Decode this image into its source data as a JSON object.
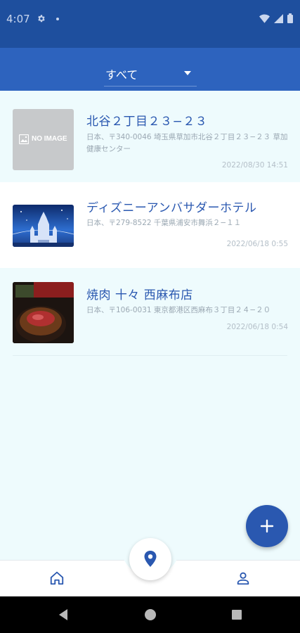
{
  "status_bar": {
    "time": "4:07"
  },
  "filter": {
    "selected": "すべて"
  },
  "places": [
    {
      "title": "北谷２丁目２３−２３",
      "address": "日本、〒340-0046 埼玉県草加市北谷２丁目２３−２３ 草加健康センター",
      "date": "2022/08/30 14:51",
      "thumb_text": "NO IMAGE",
      "thumb_type": "placeholder"
    },
    {
      "title": "ディズニーアンバサダーホテル",
      "address": "日本、〒279-8522 千葉県浦安市舞浜２−１１",
      "date": "2022/06/18 0:55",
      "thumb_type": "castle"
    },
    {
      "title": "焼肉 十々 西麻布店",
      "address": "日本、〒106-0031 東京都港区西麻布３丁目２４−２０",
      "date": "2022/06/18 0:54",
      "thumb_type": "food"
    }
  ],
  "colors": {
    "primary": "#2a58b0",
    "app_bar": "#2d63be",
    "status_bar": "#1e4f9e",
    "background": "#eefbfd"
  },
  "icons": {
    "fab": "plus-icon",
    "center": "location-pin-icon",
    "nav_left": "home-icon",
    "nav_right": "person-icon"
  }
}
